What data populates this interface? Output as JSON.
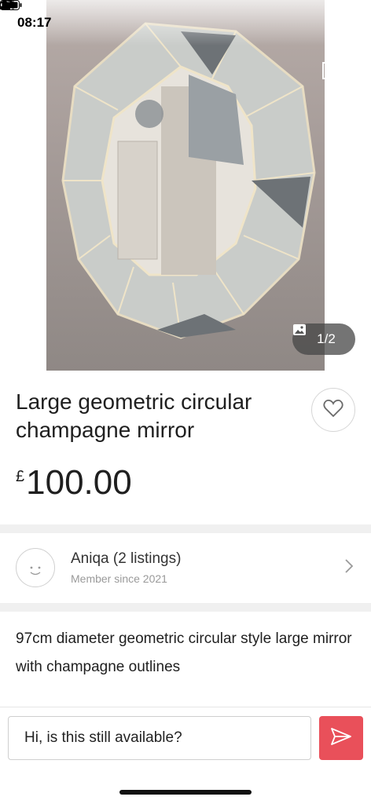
{
  "status_bar": {
    "time": "08:17"
  },
  "gallery": {
    "counter": "1/2"
  },
  "listing": {
    "title": "Large geometric circular champagne mirror",
    "currency": "£",
    "price": "100.00",
    "description": "97cm diameter geometric circular style large mirror with champagne outlines"
  },
  "seller": {
    "name": "Aniqa (2 listings)",
    "since": "Member since 2021"
  },
  "message": {
    "value": "Hi, is this still available?"
  },
  "colors": {
    "send": "#e9505a"
  }
}
